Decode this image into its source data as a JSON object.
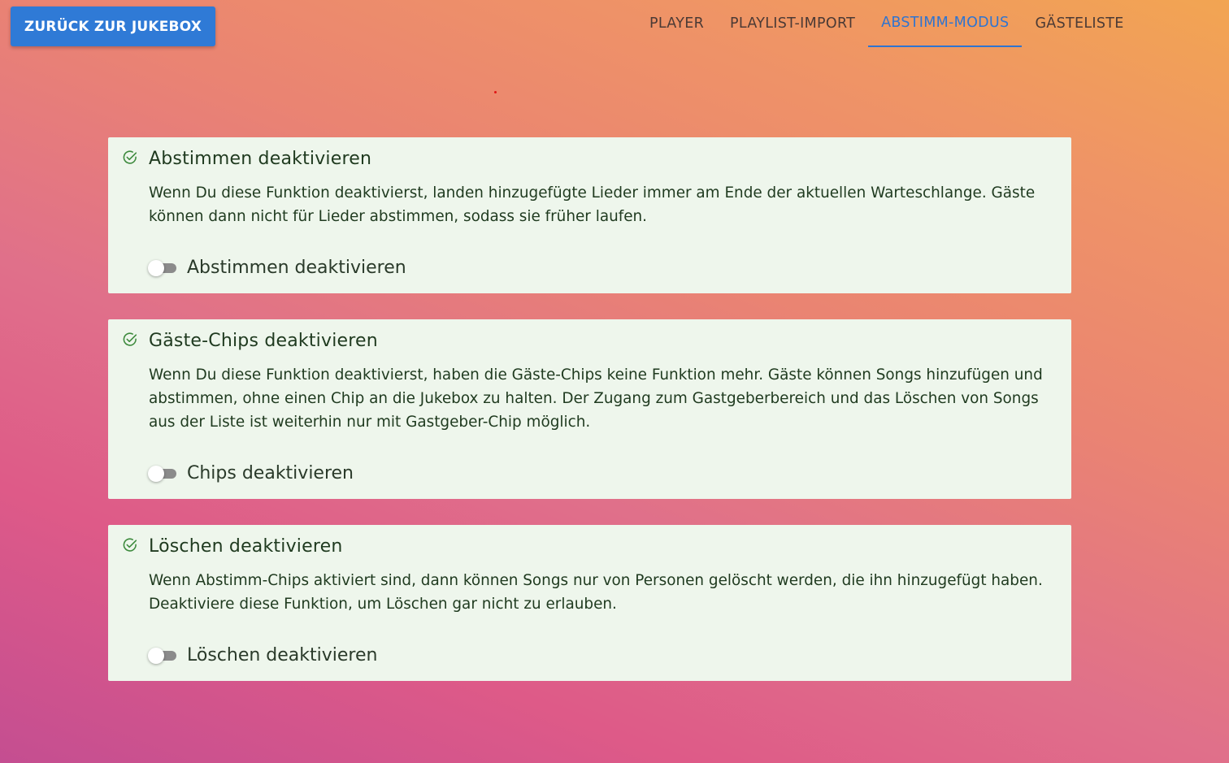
{
  "header": {
    "back_button": "ZURÜCK ZUR JUKEBOX",
    "tabs": [
      {
        "label": "PLAYER",
        "active": false
      },
      {
        "label": "PLAYLIST-IMPORT",
        "active": false
      },
      {
        "label": "ABSTIMM-MODUS",
        "active": true
      },
      {
        "label": "GÄSTELISTE",
        "active": false
      }
    ]
  },
  "cards": [
    {
      "title": "Abstimmen deaktivieren",
      "description": "Wenn Du diese Funktion deaktivierst, landen hinzugefügte Lieder immer am Ende der aktuellen Warteschlange. Gäste können dann nicht für Lieder abstimmen, sodass sie früher laufen.",
      "toggle_label": "Abstimmen deaktivieren",
      "toggle_on": false
    },
    {
      "title": "Gäste-Chips deaktivieren",
      "description": "Wenn Du diese Funktion deaktivierst, haben die Gäste-Chips keine Funktion mehr. Gäste können Songs hinzufügen und abstimmen, ohne einen Chip an die Jukebox zu halten. Der Zugang zum Gastgeberbereich und das Löschen von Songs aus der Liste ist weiterhin nur mit Gastgeber-Chip möglich.",
      "toggle_label": "Chips deaktivieren",
      "toggle_on": false
    },
    {
      "title": "Löschen deaktivieren",
      "description": "Wenn Abstimm-Chips aktiviert sind, dann können Songs nur von Personen gelöscht werden, die ihn hinzugefügt haben. Deaktiviere diese Funktion, um Löschen gar nicht zu erlauben.",
      "toggle_label": "Löschen deaktivieren",
      "toggle_on": false
    }
  ],
  "colors": {
    "accent": "#2f7ad6",
    "card_background": "#eef6ec",
    "check_icon": "#3d8a3d",
    "text": "#1f3a1f"
  }
}
